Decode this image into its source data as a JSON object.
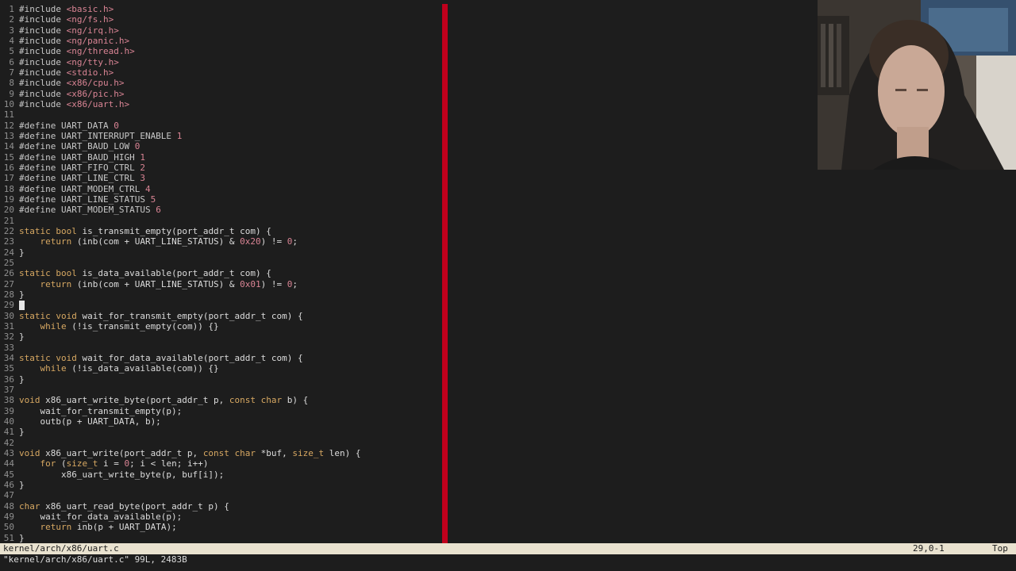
{
  "editor": {
    "lines": [
      {
        "n": "1",
        "t": [
          {
            "c": "pp",
            "v": "#include "
          },
          {
            "c": "str",
            "v": "<basic.h>"
          }
        ]
      },
      {
        "n": "2",
        "t": [
          {
            "c": "pp",
            "v": "#include "
          },
          {
            "c": "str",
            "v": "<ng/fs.h>"
          }
        ]
      },
      {
        "n": "3",
        "t": [
          {
            "c": "pp",
            "v": "#include "
          },
          {
            "c": "str",
            "v": "<ng/irq.h>"
          }
        ]
      },
      {
        "n": "4",
        "t": [
          {
            "c": "pp",
            "v": "#include "
          },
          {
            "c": "str",
            "v": "<ng/panic.h>"
          }
        ]
      },
      {
        "n": "5",
        "t": [
          {
            "c": "pp",
            "v": "#include "
          },
          {
            "c": "str",
            "v": "<ng/thread.h>"
          }
        ]
      },
      {
        "n": "6",
        "t": [
          {
            "c": "pp",
            "v": "#include "
          },
          {
            "c": "str",
            "v": "<ng/tty.h>"
          }
        ]
      },
      {
        "n": "7",
        "t": [
          {
            "c": "pp",
            "v": "#include "
          },
          {
            "c": "str",
            "v": "<stdio.h>"
          }
        ]
      },
      {
        "n": "8",
        "t": [
          {
            "c": "pp",
            "v": "#include "
          },
          {
            "c": "str",
            "v": "<x86/cpu.h>"
          }
        ]
      },
      {
        "n": "9",
        "t": [
          {
            "c": "pp",
            "v": "#include "
          },
          {
            "c": "str",
            "v": "<x86/pic.h>"
          }
        ]
      },
      {
        "n": "10",
        "t": [
          {
            "c": "pp",
            "v": "#include "
          },
          {
            "c": "str",
            "v": "<x86/uart.h>"
          }
        ]
      },
      {
        "n": "11",
        "t": []
      },
      {
        "n": "12",
        "t": [
          {
            "c": "pp",
            "v": "#define UART_DATA "
          },
          {
            "c": "num",
            "v": "0"
          }
        ]
      },
      {
        "n": "13",
        "t": [
          {
            "c": "pp",
            "v": "#define UART_INTERRUPT_ENABLE "
          },
          {
            "c": "num",
            "v": "1"
          }
        ]
      },
      {
        "n": "14",
        "t": [
          {
            "c": "pp",
            "v": "#define UART_BAUD_LOW "
          },
          {
            "c": "num",
            "v": "0"
          }
        ]
      },
      {
        "n": "15",
        "t": [
          {
            "c": "pp",
            "v": "#define UART_BAUD_HIGH "
          },
          {
            "c": "num",
            "v": "1"
          }
        ]
      },
      {
        "n": "16",
        "t": [
          {
            "c": "pp",
            "v": "#define UART_FIFO_CTRL "
          },
          {
            "c": "num",
            "v": "2"
          }
        ]
      },
      {
        "n": "17",
        "t": [
          {
            "c": "pp",
            "v": "#define UART_LINE_CTRL "
          },
          {
            "c": "num",
            "v": "3"
          }
        ]
      },
      {
        "n": "18",
        "t": [
          {
            "c": "pp",
            "v": "#define UART_MODEM_CTRL "
          },
          {
            "c": "num",
            "v": "4"
          }
        ]
      },
      {
        "n": "19",
        "t": [
          {
            "c": "pp",
            "v": "#define UART_LINE_STATUS "
          },
          {
            "c": "num",
            "v": "5"
          }
        ]
      },
      {
        "n": "20",
        "t": [
          {
            "c": "pp",
            "v": "#define UART_MODEM_STATUS "
          },
          {
            "c": "num",
            "v": "6"
          }
        ]
      },
      {
        "n": "21",
        "t": []
      },
      {
        "n": "22",
        "t": [
          {
            "c": "kw",
            "v": "static"
          },
          {
            "c": "",
            "v": " "
          },
          {
            "c": "type",
            "v": "bool"
          },
          {
            "c": "",
            "v": " is_transmit_empty(port_addr_t com) {"
          }
        ]
      },
      {
        "n": "23",
        "t": [
          {
            "c": "",
            "v": "    "
          },
          {
            "c": "kw",
            "v": "return"
          },
          {
            "c": "",
            "v": " (inb(com + UART_LINE_STATUS) & "
          },
          {
            "c": "num",
            "v": "0x20"
          },
          {
            "c": "",
            "v": ") != "
          },
          {
            "c": "num",
            "v": "0"
          },
          {
            "c": "",
            "v": ";"
          }
        ]
      },
      {
        "n": "24",
        "t": [
          {
            "c": "",
            "v": "}"
          }
        ]
      },
      {
        "n": "25",
        "t": []
      },
      {
        "n": "26",
        "t": [
          {
            "c": "kw",
            "v": "static"
          },
          {
            "c": "",
            "v": " "
          },
          {
            "c": "type",
            "v": "bool"
          },
          {
            "c": "",
            "v": " is_data_available(port_addr_t com) {"
          }
        ]
      },
      {
        "n": "27",
        "t": [
          {
            "c": "",
            "v": "    "
          },
          {
            "c": "kw",
            "v": "return"
          },
          {
            "c": "",
            "v": " (inb(com + UART_LINE_STATUS) & "
          },
          {
            "c": "num",
            "v": "0x01"
          },
          {
            "c": "",
            "v": ") != "
          },
          {
            "c": "num",
            "v": "0"
          },
          {
            "c": "",
            "v": ";"
          }
        ]
      },
      {
        "n": "28",
        "t": [
          {
            "c": "",
            "v": "}"
          }
        ]
      },
      {
        "n": "29",
        "t": []
      },
      {
        "n": "30",
        "t": [
          {
            "c": "kw",
            "v": "static"
          },
          {
            "c": "",
            "v": " "
          },
          {
            "c": "type",
            "v": "void"
          },
          {
            "c": "",
            "v": " wait_for_transmit_empty(port_addr_t com) {"
          }
        ]
      },
      {
        "n": "31",
        "t": [
          {
            "c": "",
            "v": "    "
          },
          {
            "c": "kw",
            "v": "while"
          },
          {
            "c": "",
            "v": " (!is_transmit_empty(com)) {}"
          }
        ]
      },
      {
        "n": "32",
        "t": [
          {
            "c": "",
            "v": "}"
          }
        ]
      },
      {
        "n": "33",
        "t": []
      },
      {
        "n": "34",
        "t": [
          {
            "c": "kw",
            "v": "static"
          },
          {
            "c": "",
            "v": " "
          },
          {
            "c": "type",
            "v": "void"
          },
          {
            "c": "",
            "v": " wait_for_data_available(port_addr_t com) {"
          }
        ]
      },
      {
        "n": "35",
        "t": [
          {
            "c": "",
            "v": "    "
          },
          {
            "c": "kw",
            "v": "while"
          },
          {
            "c": "",
            "v": " (!is_data_available(com)) {}"
          }
        ]
      },
      {
        "n": "36",
        "t": [
          {
            "c": "",
            "v": "}"
          }
        ]
      },
      {
        "n": "37",
        "t": []
      },
      {
        "n": "38",
        "t": [
          {
            "c": "type",
            "v": "void"
          },
          {
            "c": "",
            "v": " x86_uart_write_byte(port_addr_t p, "
          },
          {
            "c": "kw",
            "v": "const"
          },
          {
            "c": "",
            "v": " "
          },
          {
            "c": "type",
            "v": "char"
          },
          {
            "c": "",
            "v": " b) {"
          }
        ]
      },
      {
        "n": "39",
        "t": [
          {
            "c": "",
            "v": "    wait_for_transmit_empty(p);"
          }
        ]
      },
      {
        "n": "40",
        "t": [
          {
            "c": "",
            "v": "    outb(p + UART_DATA, b);"
          }
        ]
      },
      {
        "n": "41",
        "t": [
          {
            "c": "",
            "v": "}"
          }
        ]
      },
      {
        "n": "42",
        "t": []
      },
      {
        "n": "43",
        "t": [
          {
            "c": "type",
            "v": "void"
          },
          {
            "c": "",
            "v": " x86_uart_write(port_addr_t p, "
          },
          {
            "c": "kw",
            "v": "const"
          },
          {
            "c": "",
            "v": " "
          },
          {
            "c": "type",
            "v": "char"
          },
          {
            "c": "",
            "v": " *buf, "
          },
          {
            "c": "type",
            "v": "size_t"
          },
          {
            "c": "",
            "v": " len) {"
          }
        ]
      },
      {
        "n": "44",
        "t": [
          {
            "c": "",
            "v": "    "
          },
          {
            "c": "kw",
            "v": "for"
          },
          {
            "c": "",
            "v": " ("
          },
          {
            "c": "type",
            "v": "size_t"
          },
          {
            "c": "",
            "v": " i = "
          },
          {
            "c": "num",
            "v": "0"
          },
          {
            "c": "",
            "v": "; i < len; i++)"
          }
        ]
      },
      {
        "n": "45",
        "t": [
          {
            "c": "",
            "v": "        x86_uart_write_byte(p, buf[i]);"
          }
        ]
      },
      {
        "n": "46",
        "t": [
          {
            "c": "",
            "v": "}"
          }
        ]
      },
      {
        "n": "47",
        "t": []
      },
      {
        "n": "48",
        "t": [
          {
            "c": "type",
            "v": "char"
          },
          {
            "c": "",
            "v": " x86_uart_read_byte(port_addr_t p) {"
          }
        ]
      },
      {
        "n": "49",
        "t": [
          {
            "c": "",
            "v": "    wait_for_data_available(p);"
          }
        ]
      },
      {
        "n": "50",
        "t": [
          {
            "c": "",
            "v": "    "
          },
          {
            "c": "kw",
            "v": "return"
          },
          {
            "c": "",
            "v": " inb(p + UART_DATA);"
          }
        ]
      },
      {
        "n": "51",
        "t": [
          {
            "c": "",
            "v": "}"
          }
        ]
      }
    ]
  },
  "status": {
    "file": "kernel/arch/x86/uart.c",
    "position": "29,0-1",
    "scroll": "Top"
  },
  "message": "\"kernel/arch/x86/uart.c\" 99L, 2483B",
  "colors": {
    "background": "#1d1d1d",
    "preprocessor": "#c8c8c8",
    "string_literal": "#d98494",
    "number_literal": "#d98494",
    "keyword": "#d7a862",
    "color_column": "#c0001c",
    "statusline_bg": "#e9e2cf"
  }
}
